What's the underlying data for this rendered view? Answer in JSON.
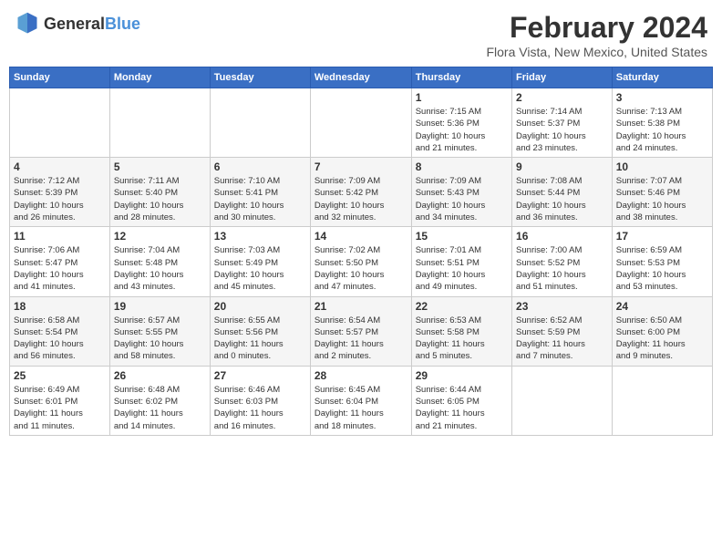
{
  "logo": {
    "general": "General",
    "blue": "Blue"
  },
  "title": "February 2024",
  "subtitle": "Flora Vista, New Mexico, United States",
  "days_of_week": [
    "Sunday",
    "Monday",
    "Tuesday",
    "Wednesday",
    "Thursday",
    "Friday",
    "Saturday"
  ],
  "weeks": [
    [
      {
        "day": "",
        "info": ""
      },
      {
        "day": "",
        "info": ""
      },
      {
        "day": "",
        "info": ""
      },
      {
        "day": "",
        "info": ""
      },
      {
        "day": "1",
        "info": "Sunrise: 7:15 AM\nSunset: 5:36 PM\nDaylight: 10 hours\nand 21 minutes."
      },
      {
        "day": "2",
        "info": "Sunrise: 7:14 AM\nSunset: 5:37 PM\nDaylight: 10 hours\nand 23 minutes."
      },
      {
        "day": "3",
        "info": "Sunrise: 7:13 AM\nSunset: 5:38 PM\nDaylight: 10 hours\nand 24 minutes."
      }
    ],
    [
      {
        "day": "4",
        "info": "Sunrise: 7:12 AM\nSunset: 5:39 PM\nDaylight: 10 hours\nand 26 minutes."
      },
      {
        "day": "5",
        "info": "Sunrise: 7:11 AM\nSunset: 5:40 PM\nDaylight: 10 hours\nand 28 minutes."
      },
      {
        "day": "6",
        "info": "Sunrise: 7:10 AM\nSunset: 5:41 PM\nDaylight: 10 hours\nand 30 minutes."
      },
      {
        "day": "7",
        "info": "Sunrise: 7:09 AM\nSunset: 5:42 PM\nDaylight: 10 hours\nand 32 minutes."
      },
      {
        "day": "8",
        "info": "Sunrise: 7:09 AM\nSunset: 5:43 PM\nDaylight: 10 hours\nand 34 minutes."
      },
      {
        "day": "9",
        "info": "Sunrise: 7:08 AM\nSunset: 5:44 PM\nDaylight: 10 hours\nand 36 minutes."
      },
      {
        "day": "10",
        "info": "Sunrise: 7:07 AM\nSunset: 5:46 PM\nDaylight: 10 hours\nand 38 minutes."
      }
    ],
    [
      {
        "day": "11",
        "info": "Sunrise: 7:06 AM\nSunset: 5:47 PM\nDaylight: 10 hours\nand 41 minutes."
      },
      {
        "day": "12",
        "info": "Sunrise: 7:04 AM\nSunset: 5:48 PM\nDaylight: 10 hours\nand 43 minutes."
      },
      {
        "day": "13",
        "info": "Sunrise: 7:03 AM\nSunset: 5:49 PM\nDaylight: 10 hours\nand 45 minutes."
      },
      {
        "day": "14",
        "info": "Sunrise: 7:02 AM\nSunset: 5:50 PM\nDaylight: 10 hours\nand 47 minutes."
      },
      {
        "day": "15",
        "info": "Sunrise: 7:01 AM\nSunset: 5:51 PM\nDaylight: 10 hours\nand 49 minutes."
      },
      {
        "day": "16",
        "info": "Sunrise: 7:00 AM\nSunset: 5:52 PM\nDaylight: 10 hours\nand 51 minutes."
      },
      {
        "day": "17",
        "info": "Sunrise: 6:59 AM\nSunset: 5:53 PM\nDaylight: 10 hours\nand 53 minutes."
      }
    ],
    [
      {
        "day": "18",
        "info": "Sunrise: 6:58 AM\nSunset: 5:54 PM\nDaylight: 10 hours\nand 56 minutes."
      },
      {
        "day": "19",
        "info": "Sunrise: 6:57 AM\nSunset: 5:55 PM\nDaylight: 10 hours\nand 58 minutes."
      },
      {
        "day": "20",
        "info": "Sunrise: 6:55 AM\nSunset: 5:56 PM\nDaylight: 11 hours\nand 0 minutes."
      },
      {
        "day": "21",
        "info": "Sunrise: 6:54 AM\nSunset: 5:57 PM\nDaylight: 11 hours\nand 2 minutes."
      },
      {
        "day": "22",
        "info": "Sunrise: 6:53 AM\nSunset: 5:58 PM\nDaylight: 11 hours\nand 5 minutes."
      },
      {
        "day": "23",
        "info": "Sunrise: 6:52 AM\nSunset: 5:59 PM\nDaylight: 11 hours\nand 7 minutes."
      },
      {
        "day": "24",
        "info": "Sunrise: 6:50 AM\nSunset: 6:00 PM\nDaylight: 11 hours\nand 9 minutes."
      }
    ],
    [
      {
        "day": "25",
        "info": "Sunrise: 6:49 AM\nSunset: 6:01 PM\nDaylight: 11 hours\nand 11 minutes."
      },
      {
        "day": "26",
        "info": "Sunrise: 6:48 AM\nSunset: 6:02 PM\nDaylight: 11 hours\nand 14 minutes."
      },
      {
        "day": "27",
        "info": "Sunrise: 6:46 AM\nSunset: 6:03 PM\nDaylight: 11 hours\nand 16 minutes."
      },
      {
        "day": "28",
        "info": "Sunrise: 6:45 AM\nSunset: 6:04 PM\nDaylight: 11 hours\nand 18 minutes."
      },
      {
        "day": "29",
        "info": "Sunrise: 6:44 AM\nSunset: 6:05 PM\nDaylight: 11 hours\nand 21 minutes."
      },
      {
        "day": "",
        "info": ""
      },
      {
        "day": "",
        "info": ""
      }
    ]
  ]
}
